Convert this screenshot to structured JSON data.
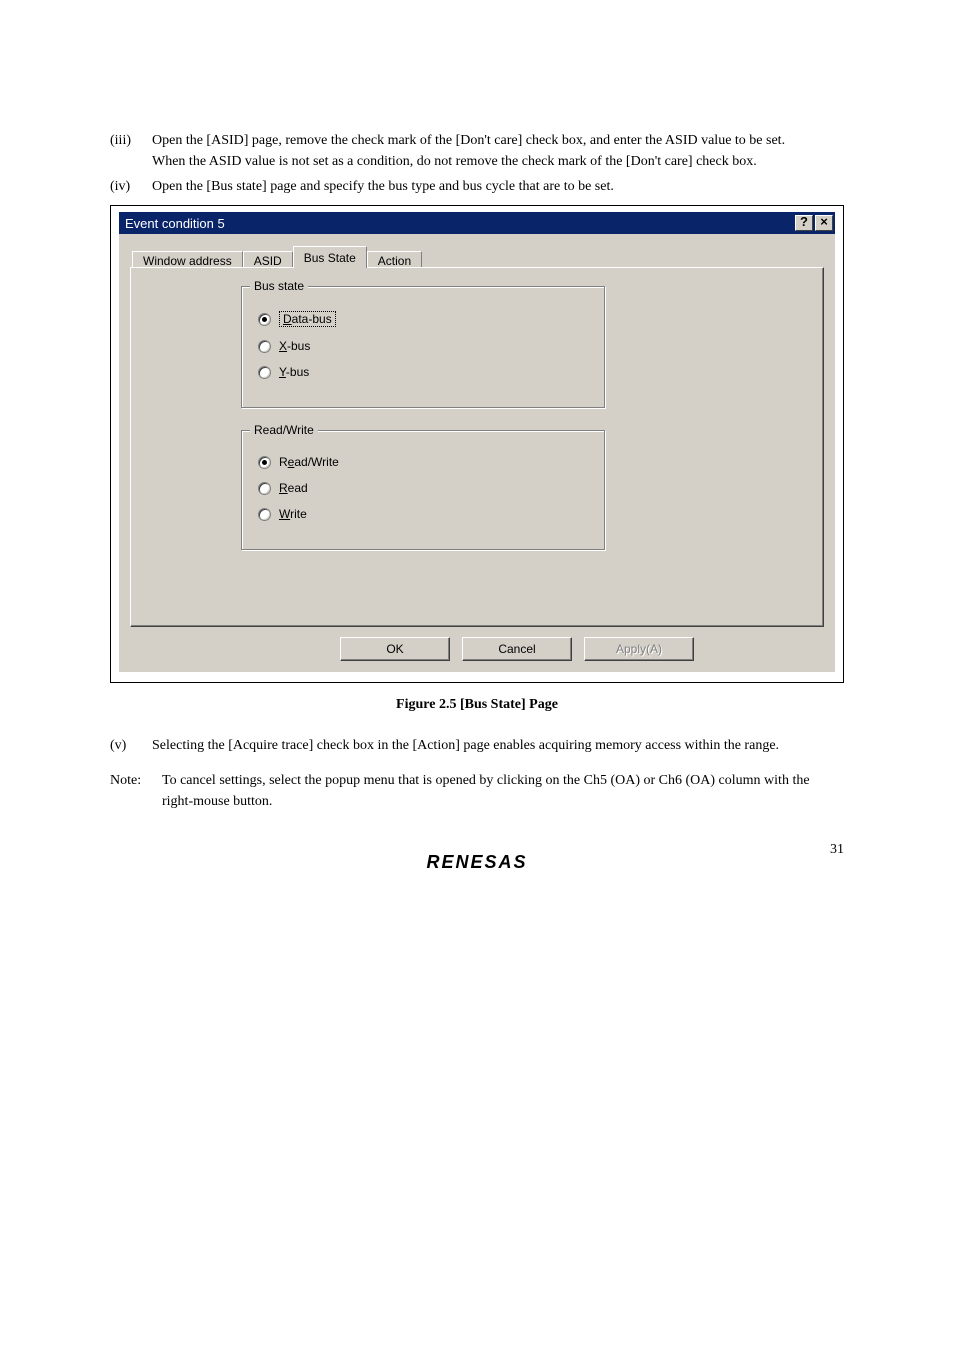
{
  "list": {
    "iii": {
      "num": "(iii)",
      "line1": "Open the [ASID] page, remove the check mark of the [Don't care] check box, and enter the ASID value to be set.",
      "line2": "When the ASID value is not set as a condition, do not remove the check mark of the [Don't care] check box."
    },
    "iv": {
      "num": "(iv)",
      "line1": "Open the [Bus state] page and specify the bus type and bus cycle that are to be set."
    },
    "v": {
      "num": "(v)",
      "line1": "Selecting the [Acquire trace] check box in the [Action] page enables acquiring memory access within the range."
    }
  },
  "dialog": {
    "title": "Event condition 5",
    "help_btn": "?",
    "close_btn": "×",
    "tabs": {
      "t1": "Window address",
      "t2": "ASID",
      "t3": "Bus State",
      "t4": "Action"
    },
    "group1": {
      "legend": "Bus state",
      "opt1_full": "Data-bus",
      "opt1_u": "D",
      "opt1_rest": "ata-bus",
      "opt2_u": "X",
      "opt2_rest": "-bus",
      "opt3_u": "Y",
      "opt3_rest": "-bus"
    },
    "group2": {
      "legend": "Read/Write",
      "opt1_pre": "R",
      "opt1_u": "e",
      "opt1_rest": "ad/Write",
      "opt2_u": "R",
      "opt2_rest": "ead",
      "opt3_u": "W",
      "opt3_rest": "rite"
    },
    "buttons": {
      "ok": "OK",
      "cancel": "Cancel",
      "apply": "Apply(A)"
    }
  },
  "caption": "Figure 2.5   [Bus State] Page",
  "note": {
    "label": "Note:",
    "body": "To cancel settings, select the popup menu that is opened by clicking on the Ch5 (OA) or Ch6 (OA) column with the right-mouse button."
  },
  "footer": {
    "logo": "RENESAS",
    "page": "31"
  }
}
